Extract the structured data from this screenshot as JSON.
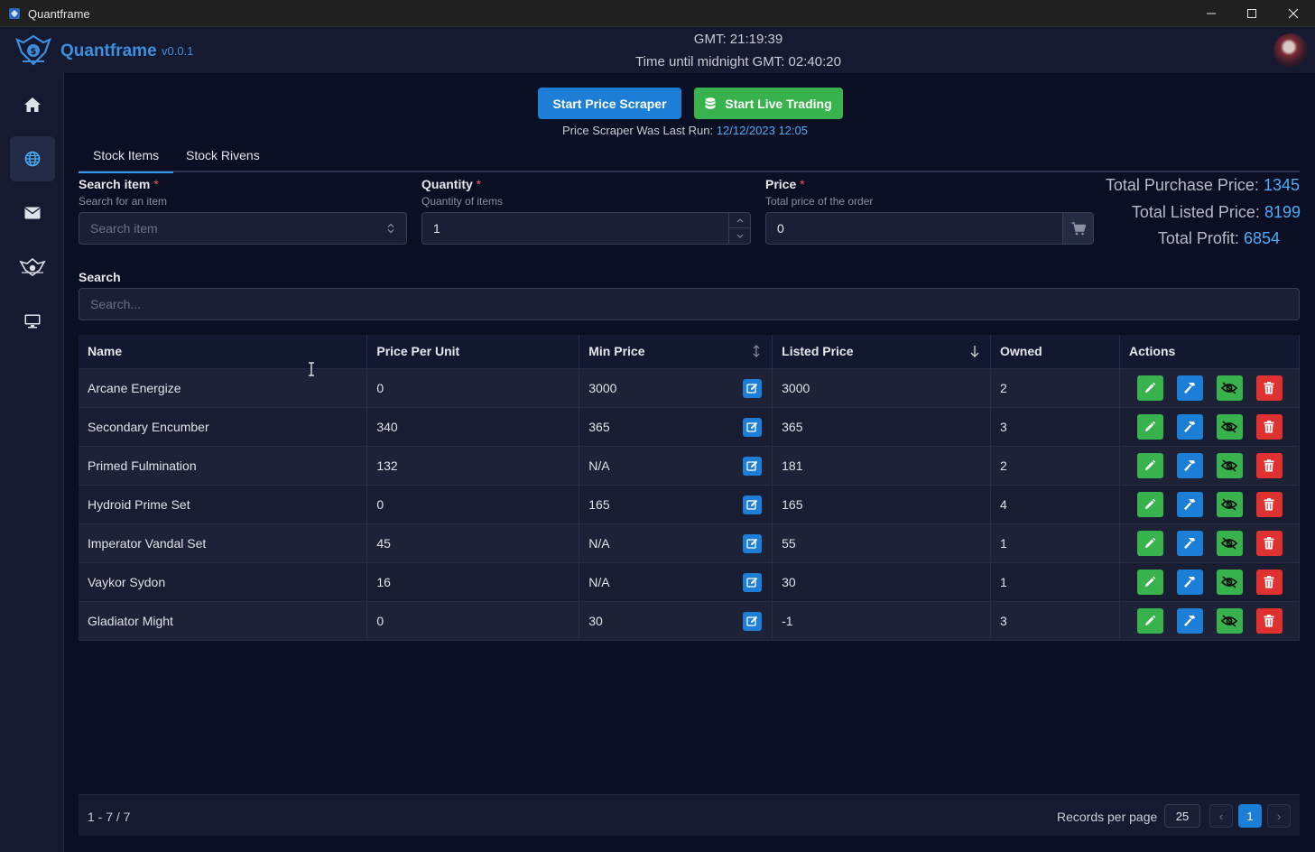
{
  "window": {
    "title": "Quantframe"
  },
  "header": {
    "brand": "Quantframe",
    "version": "v0.0.1",
    "gmt_time": "GMT: 21:19:39",
    "until_midnight": "Time until midnight GMT: 02:40:20"
  },
  "sidebar": {
    "items": [
      {
        "icon": "home-icon"
      },
      {
        "icon": "globe-icon",
        "active": true
      },
      {
        "icon": "envelope-icon"
      },
      {
        "icon": "warframe-icon"
      },
      {
        "icon": "monitor-icon"
      }
    ]
  },
  "toolbar": {
    "scraper_label": "Start Price Scraper",
    "live_label": "Start Live Trading",
    "last_run_label": "Price Scraper Was Last Run:",
    "last_run_value": "12/12/2023 12:05"
  },
  "tabs": [
    {
      "label": "Stock Items",
      "active": true
    },
    {
      "label": "Stock Rivens",
      "active": false
    }
  ],
  "form": {
    "search_item": {
      "label": "Search item",
      "required": "*",
      "description": "Search for an item",
      "placeholder": "Search item"
    },
    "quantity": {
      "label": "Quantity",
      "required": "*",
      "description": "Quantity of items",
      "value": "1"
    },
    "price": {
      "label": "Price",
      "required": "*",
      "description": "Total price of the order",
      "value": "0"
    }
  },
  "totals": {
    "purchase_label": "Total Purchase Price:",
    "purchase_value": "1345",
    "listed_label": "Total Listed Price:",
    "listed_value": "8199",
    "profit_label": "Total Profit:",
    "profit_value": "6854"
  },
  "search": {
    "label": "Search",
    "placeholder": "Search..."
  },
  "table": {
    "columns": [
      "Name",
      "Price Per Unit",
      "Min Price",
      "Listed Price",
      "Owned",
      "Actions"
    ],
    "rows": [
      {
        "name": "Arcane Energize",
        "price_per_unit": "0",
        "min_price": "3000",
        "listed_price": "3000",
        "owned": "2"
      },
      {
        "name": "Secondary Encumber",
        "price_per_unit": "340",
        "min_price": "365",
        "listed_price": "365",
        "owned": "3"
      },
      {
        "name": "Primed Fulmination",
        "price_per_unit": "132",
        "min_price": "N/A",
        "listed_price": "181",
        "owned": "2"
      },
      {
        "name": "Hydroid Prime Set",
        "price_per_unit": "0",
        "min_price": "165",
        "listed_price": "165",
        "owned": "4"
      },
      {
        "name": "Imperator Vandal Set",
        "price_per_unit": "45",
        "min_price": "N/A",
        "listed_price": "55",
        "owned": "1"
      },
      {
        "name": "Vaykor Sydon",
        "price_per_unit": "16",
        "min_price": "N/A",
        "listed_price": "30",
        "owned": "1"
      },
      {
        "name": "Gladiator Might",
        "price_per_unit": "0",
        "min_price": "30",
        "listed_price": "-1",
        "owned": "3"
      }
    ]
  },
  "footer": {
    "range": "1 - 7 / 7",
    "records_per_page_label": "Records per page",
    "records_per_page": "25",
    "current_page": "1",
    "prev": "‹",
    "next": "›"
  }
}
